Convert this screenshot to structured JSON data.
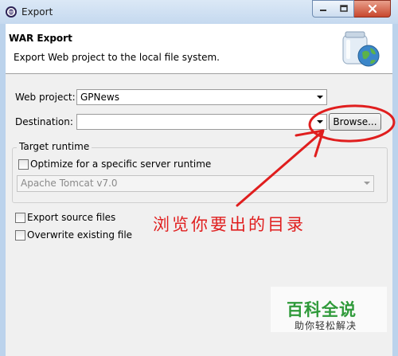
{
  "window": {
    "title": "Export"
  },
  "header": {
    "title": "WAR Export",
    "description": "Export Web project to the local file system."
  },
  "form": {
    "web_project_label": "Web project:",
    "web_project_value": "GPNews",
    "destination_label": "Destination:",
    "destination_value": "",
    "browse_label": "Browse...",
    "target_runtime": {
      "title": "Target runtime",
      "optimize_label": "Optimize for a specific server runtime",
      "optimize_checked": false,
      "runtime_value": "Apache Tomcat v7.0"
    },
    "export_source_label": "Export source files",
    "export_source_checked": false,
    "overwrite_label": "Overwrite existing file",
    "overwrite_checked": false
  },
  "annotation": {
    "text": "浏览你要出的目录",
    "color": "#e01e1e"
  },
  "watermark": {
    "title": "百科全说",
    "subtitle": "助你轻松解决",
    "color": "#2f9a3a"
  }
}
